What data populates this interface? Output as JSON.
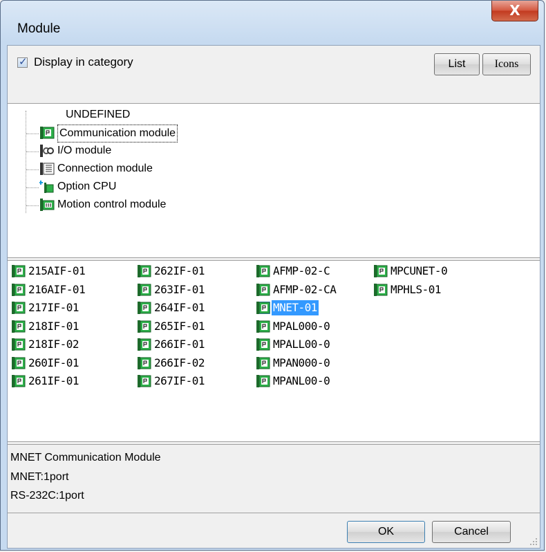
{
  "window": {
    "title": "Module",
    "close_label": "X"
  },
  "top": {
    "display_in_category_label": "Display in category",
    "display_in_category_checked": true,
    "list_button": "List",
    "icons_button": "Icons"
  },
  "tree": {
    "items": [
      {
        "label": "UNDEFINED",
        "icon": "none"
      },
      {
        "label": "Communication module",
        "icon": "communication-module-icon"
      },
      {
        "label": "I/O module",
        "icon": "io-module-icon"
      },
      {
        "label": "Connection module",
        "icon": "connection-module-icon"
      },
      {
        "label": "Option CPU",
        "icon": "option-cpu-icon"
      },
      {
        "label": "Motion control module",
        "icon": "motion-control-module-icon"
      }
    ]
  },
  "modules": {
    "col1": [
      "215AIF-01",
      "216AIF-01",
      "217IF-01",
      "218IF-01",
      "218IF-02",
      "260IF-01",
      "261IF-01"
    ],
    "col2": [
      "262IF-01",
      "263IF-01",
      "264IF-01",
      "265IF-01",
      "266IF-01",
      "266IF-02",
      "267IF-01"
    ],
    "col3": [
      "AFMP-02-C",
      "AFMP-02-CA",
      "MNET-01",
      "MPAL000-0",
      "MPALL00-0",
      "MPAN000-0",
      "MPANL00-0"
    ],
    "col4": [
      "MPCUNET-0",
      "MPHLS-01"
    ],
    "selected": "MNET-01"
  },
  "description": {
    "line1": "MNET Communication Module",
    "line2": "MNET:1port",
    "line3": "RS-232C:1port"
  },
  "footer": {
    "ok": "OK",
    "cancel": "Cancel"
  },
  "colors": {
    "selection": "#3399ff",
    "module_icon_green": "#2db04a"
  }
}
